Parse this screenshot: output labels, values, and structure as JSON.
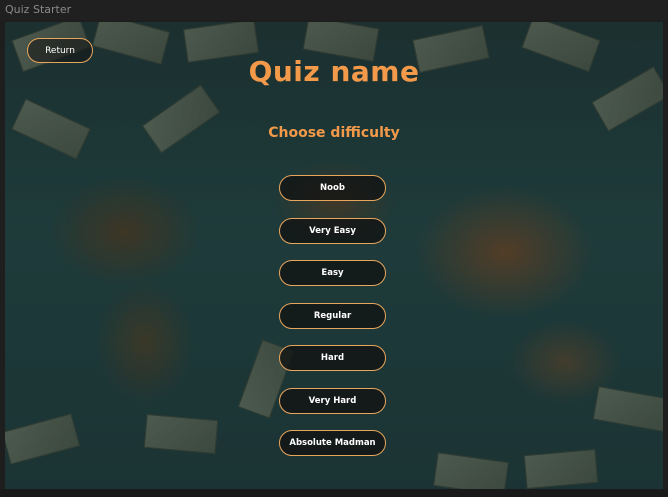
{
  "window": {
    "title": "Quiz Starter"
  },
  "nav": {
    "return_label": "Return"
  },
  "quiz": {
    "title": "Quiz name",
    "subtitle": "Choose difficulty"
  },
  "difficulties": [
    "Noob",
    "Very Easy",
    "Easy",
    "Regular",
    "Hard",
    "Very Hard",
    "Absolute Madman"
  ],
  "colors": {
    "accent": "#f39a4a",
    "button_border": "#e8a55c",
    "button_bg": "#121212",
    "text": "#ffffff"
  }
}
